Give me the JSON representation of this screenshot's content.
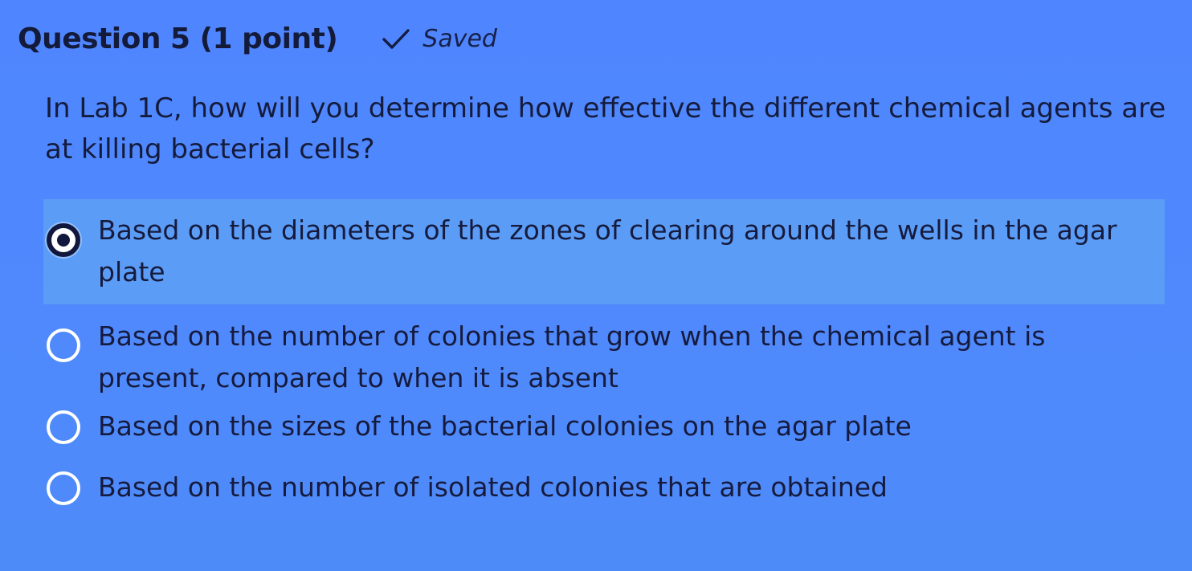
{
  "question": {
    "title": "Question 5 (1 point)",
    "status": "Saved",
    "prompt": "In Lab 1C, how will you determine how effective the different chemical agents are at killing bacterial cells?"
  },
  "options": [
    {
      "label": "Based on the diameters of the zones of clearing around the wells in the agar plate",
      "selected": true
    },
    {
      "label": "Based on the number of colonies that grow when the chemical agent is present, compared to when it is absent",
      "selected": false
    },
    {
      "label": "Based on the sizes of the bacterial colonies on the agar plate",
      "selected": false
    },
    {
      "label": "Based on the number of isolated colonies that are obtained",
      "selected": false
    }
  ],
  "icons": {
    "saved": "check-icon",
    "radio_selected": "radio-selected-icon",
    "radio_unselected": "radio-unselected-icon"
  },
  "colors": {
    "background": "#4f89fd",
    "selected_option_background": "#5b9cf6",
    "text": "#151b3b",
    "radio_unselected": "#ffffff"
  }
}
